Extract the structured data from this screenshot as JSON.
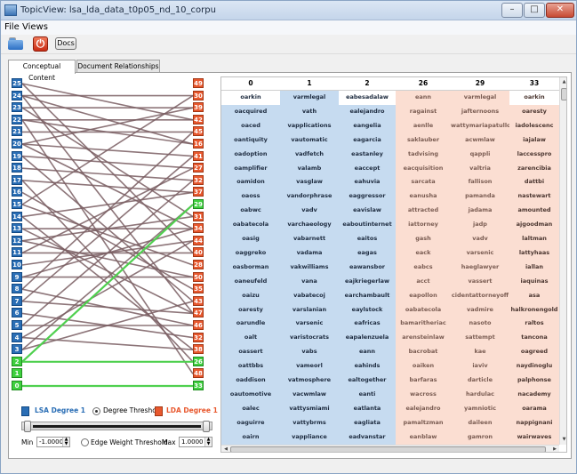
{
  "window": {
    "title": "TopicView: lsa_lda_data_t0p05_nd_10_corpu"
  },
  "window_controls": {
    "minimize": "–",
    "maximize": "□",
    "close": "✕"
  },
  "menu": {
    "file": "File",
    "views": "Views"
  },
  "toolbar": {
    "docs_label": "Docs",
    "power_glyph": "⏻",
    "open_icon": "folder-open-icon",
    "power_icon": "power-icon"
  },
  "tabs": {
    "conceptual": "Conceptual Content",
    "document_relationships": "Document Relationships"
  },
  "graph": {
    "left_nodes": [
      "25",
      "24",
      "23",
      "22",
      "21",
      "20",
      "19",
      "18",
      "17",
      "16",
      "15",
      "14",
      "13",
      "12",
      "11",
      "10",
      "9",
      "8",
      "7",
      "6",
      "5",
      "4",
      "3",
      "2",
      "1",
      "0"
    ],
    "right_nodes": [
      "49",
      "30",
      "39",
      "42",
      "45",
      "16",
      "41",
      "27",
      "32",
      "37",
      "29",
      "31",
      "34",
      "44",
      "40",
      "28",
      "50",
      "35",
      "43",
      "47",
      "46",
      "32",
      "38",
      "26",
      "48",
      "33"
    ],
    "green_left": [
      "2",
      "1",
      "0"
    ],
    "green_right": [
      "29",
      "26",
      "33"
    ],
    "edge_color": "#7a5e62",
    "green_edge_color": "#4fd04f"
  },
  "legend": {
    "lsa_label": "LSA Degree 1",
    "degree_threshold_label": "Degree Threshold",
    "lda_label": "LDA Degree 1",
    "min_label": "Min",
    "min_value": "-1.0000",
    "edge_weight_label": "Edge Weight Threshold",
    "max_label": "Max",
    "max_value": "1.0000",
    "lsa_color": "#2a6eb5",
    "lda_color": "#e8582e",
    "degree_threshold_selected": true,
    "edge_weight_selected": false
  },
  "table": {
    "columns": [
      {
        "header": "0",
        "kind": "blue",
        "cells": [
          "oarkin",
          "oacquired",
          "oaced",
          "oantiquity",
          "oadoption",
          "oamplifier",
          "oamidon",
          "oaoss",
          "oabwc",
          "oabatecola",
          "oasig",
          "oaggreko",
          "oasborman",
          "oaneufeld",
          "oaizu",
          "oaresty",
          "oarundle",
          "oalt",
          "oassert",
          "oattbbs",
          "oaddison",
          "oautomotive",
          "oalec",
          "oaguirre",
          "oairn"
        ]
      },
      {
        "header": "1",
        "kind": "blue",
        "cells": [
          "varmlegal",
          "vath",
          "vapplications",
          "vautomatic",
          "vadfetch",
          "valamb",
          "vasglaw",
          "vandorphrase",
          "vadv",
          "varchaeology",
          "vabarnett",
          "vadama",
          "vakwilliams",
          "vana",
          "vabatecoj",
          "varslanian",
          "varsenic",
          "varistocrats",
          "vabs",
          "vameorl",
          "vatmosphere",
          "vacwmlaw",
          "vattysmiami",
          "vattybrms",
          "vappliance"
        ]
      },
      {
        "header": "2",
        "kind": "blue",
        "cells": [
          "eabesadalaw",
          "ealejandro",
          "eangelia",
          "eagarcia",
          "eastanley",
          "eaccept",
          "eahuvia",
          "eaggressor",
          "eavislaw",
          "eaboutinternet",
          "eaitos",
          "eagas",
          "eawansbor",
          "eajkriegerlaw",
          "earchambault",
          "eaylstock",
          "eafricas",
          "eapalenzuela",
          "eann",
          "eahinds",
          "ealtogether",
          "eanti",
          "eatlanta",
          "eagliata",
          "eadvanstar"
        ]
      },
      {
        "header": "26",
        "kind": "pink",
        "cells": [
          "eann",
          "ragainst",
          "aenlle",
          "saklauber",
          "tadvising",
          "eacquisition",
          "sarcata",
          "eanusha",
          "attracted",
          "iattorney",
          "gash",
          "eack",
          "eabcs",
          "acct",
          "eapollon",
          "oabatecola",
          "bamaritheriac",
          "arensteinlaw",
          "bacrobat",
          "oaiken",
          "barfaras",
          "wacross",
          "ealejandro",
          "pamaltzman",
          "eanblaw"
        ]
      },
      {
        "header": "29",
        "kind": "pink",
        "cells": [
          "varmlegal",
          "jafternoons",
          "wattymariapatullo",
          "acwmlaw",
          "qappli",
          "valtria",
          "fallison",
          "pamanda",
          "jadama",
          "jadp",
          "vadv",
          "varsenic",
          "haeglawyer",
          "vassert",
          "cidentattorneyoff",
          "vadmire",
          "nasoto",
          "sattempt",
          "kae",
          "iaviv",
          "darticle",
          "hardulac",
          "yamniotic",
          "daileen",
          "gamron"
        ]
      },
      {
        "header": "33",
        "kind": "pink",
        "cells": [
          "oarkin",
          "oaresty",
          "iadolescenc",
          "iajalaw",
          "laccesspro",
          "zarencibia",
          "dattbi",
          "nastewart",
          "amounted",
          "ajgoodman",
          "laltman",
          "lattyhaas",
          "iallan",
          "iaquinas",
          "asa",
          "halkronengold",
          "raltos",
          "tancona",
          "oagreed",
          "naydinoglu",
          "palphonse",
          "nacademy",
          "oarama",
          "nappignani",
          "wairwaves"
        ]
      }
    ],
    "highlight_row_cols": [
      "0",
      "2",
      "33"
    ]
  }
}
